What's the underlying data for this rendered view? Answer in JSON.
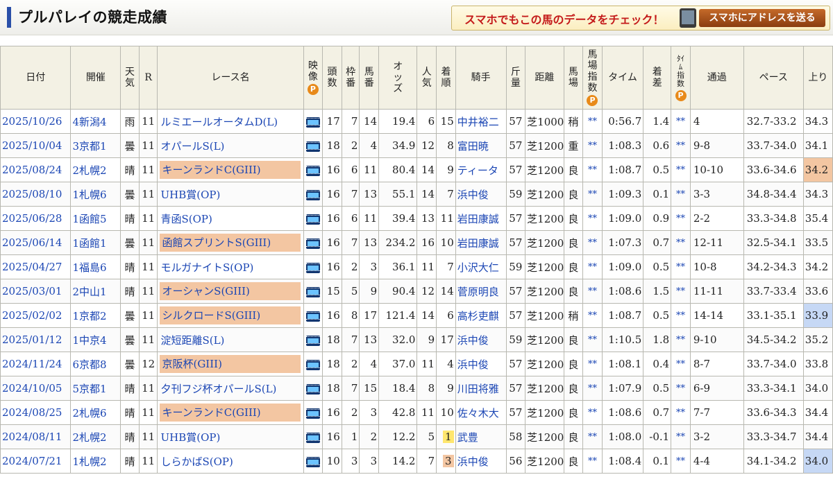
{
  "header": {
    "title": "プルパレイの競走成績",
    "promo_text": "スマホでもこの馬のデータをチェック！",
    "send_button": "スマホにアドレスを送る"
  },
  "columns": {
    "date": "日付",
    "venue": "開催",
    "weather": "天気",
    "race_no": "R",
    "race_name": "レース名",
    "video": "映像",
    "badge": "P",
    "runners": "頭数",
    "frame": "枠番",
    "horse_no": "馬番",
    "odds": "オッズ",
    "popularity": "人気",
    "finish": "着順",
    "jockey": "騎手",
    "weight": "斤量",
    "distance": "距離",
    "track": "馬場",
    "track_index": "馬場指数",
    "time": "タイム",
    "margin": "着差",
    "time_index": "ﾀｲﾑ指数",
    "passing": "通過",
    "pace": "ペース",
    "last": "上り"
  },
  "rows": [
    {
      "date": "2025/10/26",
      "venue": "4新潟4",
      "weather": "雨",
      "race_no": "11",
      "race_name": "ルミエールオータムD(L)",
      "graded": false,
      "runners": "17",
      "frame": "7",
      "horse_no": "14",
      "odds": "19.4",
      "popularity": "6",
      "finish": "15",
      "finish_hl": "",
      "jockey": "中井裕二",
      "weight": "57",
      "distance": "芝1000",
      "track": "稍",
      "track_index": "**",
      "time": "0:56.7",
      "margin": "1.4",
      "time_index": "**",
      "passing": "4",
      "pace": "32.7-33.2",
      "last": "34.3",
      "last_hl": ""
    },
    {
      "date": "2025/10/04",
      "venue": "3京都1",
      "weather": "曇",
      "race_no": "11",
      "race_name": "オパールS(L)",
      "graded": false,
      "runners": "18",
      "frame": "2",
      "horse_no": "4",
      "odds": "34.9",
      "popularity": "12",
      "finish": "8",
      "finish_hl": "",
      "jockey": "富田暁",
      "weight": "57",
      "distance": "芝1200",
      "track": "重",
      "track_index": "**",
      "time": "1:08.3",
      "margin": "0.6",
      "time_index": "**",
      "passing": "9-8",
      "pace": "33.7-34.0",
      "last": "34.1",
      "last_hl": ""
    },
    {
      "date": "2025/08/24",
      "venue": "2札幌2",
      "weather": "晴",
      "race_no": "11",
      "race_name": "キーンランドC(GIII)",
      "graded": true,
      "runners": "16",
      "frame": "6",
      "horse_no": "11",
      "odds": "80.4",
      "popularity": "14",
      "finish": "9",
      "finish_hl": "",
      "jockey": "ティータ",
      "weight": "57",
      "distance": "芝1200",
      "track": "良",
      "track_index": "**",
      "time": "1:08.7",
      "margin": "0.5",
      "time_index": "**",
      "passing": "10-10",
      "pace": "33.6-34.6",
      "last": "34.2",
      "last_hl": "orange"
    },
    {
      "date": "2025/08/10",
      "venue": "1札幌6",
      "weather": "曇",
      "race_no": "11",
      "race_name": "UHB賞(OP)",
      "graded": false,
      "runners": "16",
      "frame": "7",
      "horse_no": "13",
      "odds": "55.1",
      "popularity": "14",
      "finish": "7",
      "finish_hl": "",
      "jockey": "浜中俊",
      "weight": "59",
      "distance": "芝1200",
      "track": "良",
      "track_index": "**",
      "time": "1:09.3",
      "margin": "0.1",
      "time_index": "**",
      "passing": "3-3",
      "pace": "34.8-34.4",
      "last": "34.3",
      "last_hl": ""
    },
    {
      "date": "2025/06/28",
      "venue": "1函館5",
      "weather": "晴",
      "race_no": "11",
      "race_name": "青函S(OP)",
      "graded": false,
      "runners": "16",
      "frame": "6",
      "horse_no": "11",
      "odds": "39.4",
      "popularity": "13",
      "finish": "11",
      "finish_hl": "",
      "jockey": "岩田康誠",
      "weight": "57",
      "distance": "芝1200",
      "track": "良",
      "track_index": "**",
      "time": "1:09.0",
      "margin": "0.9",
      "time_index": "**",
      "passing": "2-2",
      "pace": "33.3-34.8",
      "last": "35.4",
      "last_hl": ""
    },
    {
      "date": "2025/06/14",
      "venue": "1函館1",
      "weather": "曇",
      "race_no": "11",
      "race_name": "函館スプリントS(GIII)",
      "graded": true,
      "runners": "16",
      "frame": "7",
      "horse_no": "13",
      "odds": "234.2",
      "popularity": "16",
      "finish": "10",
      "finish_hl": "",
      "jockey": "岩田康誠",
      "weight": "57",
      "distance": "芝1200",
      "track": "良",
      "track_index": "**",
      "time": "1:07.3",
      "margin": "0.7",
      "time_index": "**",
      "passing": "12-11",
      "pace": "32.5-34.1",
      "last": "33.5",
      "last_hl": ""
    },
    {
      "date": "2025/04/27",
      "venue": "1福島6",
      "weather": "晴",
      "race_no": "11",
      "race_name": "モルガナイトS(OP)",
      "graded": false,
      "runners": "16",
      "frame": "2",
      "horse_no": "3",
      "odds": "36.1",
      "popularity": "11",
      "finish": "7",
      "finish_hl": "",
      "jockey": "小沢大仁",
      "weight": "59",
      "distance": "芝1200",
      "track": "良",
      "track_index": "**",
      "time": "1:09.0",
      "margin": "0.5",
      "time_index": "**",
      "passing": "10-8",
      "pace": "34.2-34.3",
      "last": "34.2",
      "last_hl": ""
    },
    {
      "date": "2025/03/01",
      "venue": "2中山1",
      "weather": "晴",
      "race_no": "11",
      "race_name": "オーシャンS(GIII)",
      "graded": true,
      "runners": "15",
      "frame": "5",
      "horse_no": "9",
      "odds": "90.4",
      "popularity": "12",
      "finish": "14",
      "finish_hl": "",
      "jockey": "菅原明良",
      "weight": "57",
      "distance": "芝1200",
      "track": "良",
      "track_index": "**",
      "time": "1:08.6",
      "margin": "1.5",
      "time_index": "**",
      "passing": "11-11",
      "pace": "33.7-33.4",
      "last": "33.6",
      "last_hl": ""
    },
    {
      "date": "2025/02/02",
      "venue": "1京都2",
      "weather": "曇",
      "race_no": "11",
      "race_name": "シルクロードS(GIII)",
      "graded": true,
      "runners": "16",
      "frame": "8",
      "horse_no": "17",
      "odds": "121.4",
      "popularity": "14",
      "finish": "6",
      "finish_hl": "",
      "jockey": "高杉吏麒",
      "weight": "57",
      "distance": "芝1200",
      "track": "稍",
      "track_index": "**",
      "time": "1:08.7",
      "margin": "0.5",
      "time_index": "**",
      "passing": "14-14",
      "pace": "33.1-35.1",
      "last": "33.9",
      "last_hl": "blue"
    },
    {
      "date": "2025/01/12",
      "venue": "1中京4",
      "weather": "曇",
      "race_no": "11",
      "race_name": "淀短距離S(L)",
      "graded": false,
      "runners": "18",
      "frame": "7",
      "horse_no": "13",
      "odds": "32.0",
      "popularity": "9",
      "finish": "17",
      "finish_hl": "",
      "jockey": "浜中俊",
      "weight": "59",
      "distance": "芝1200",
      "track": "良",
      "track_index": "**",
      "time": "1:10.5",
      "margin": "1.8",
      "time_index": "**",
      "passing": "9-10",
      "pace": "34.5-34.2",
      "last": "35.2",
      "last_hl": ""
    },
    {
      "date": "2024/11/24",
      "venue": "6京都8",
      "weather": "曇",
      "race_no": "12",
      "race_name": "京阪杯(GIII)",
      "graded": true,
      "runners": "18",
      "frame": "2",
      "horse_no": "4",
      "odds": "37.0",
      "popularity": "11",
      "finish": "4",
      "finish_hl": "",
      "jockey": "浜中俊",
      "weight": "57",
      "distance": "芝1200",
      "track": "良",
      "track_index": "**",
      "time": "1:08.1",
      "margin": "0.4",
      "time_index": "**",
      "passing": "8-7",
      "pace": "33.7-34.0",
      "last": "33.8",
      "last_hl": ""
    },
    {
      "date": "2024/10/05",
      "venue": "5京都1",
      "weather": "晴",
      "race_no": "11",
      "race_name": "夕刊フジ杯オパールS(L)",
      "graded": false,
      "runners": "18",
      "frame": "7",
      "horse_no": "15",
      "odds": "18.4",
      "popularity": "8",
      "finish": "9",
      "finish_hl": "",
      "jockey": "川田将雅",
      "weight": "57",
      "distance": "芝1200",
      "track": "良",
      "track_index": "**",
      "time": "1:07.9",
      "margin": "0.5",
      "time_index": "**",
      "passing": "6-9",
      "pace": "33.3-34.1",
      "last": "34.0",
      "last_hl": ""
    },
    {
      "date": "2024/08/25",
      "venue": "2札幌6",
      "weather": "晴",
      "race_no": "11",
      "race_name": "キーンランドC(GIII)",
      "graded": true,
      "runners": "16",
      "frame": "2",
      "horse_no": "3",
      "odds": "42.8",
      "popularity": "11",
      "finish": "10",
      "finish_hl": "",
      "jockey": "佐々木大",
      "weight": "57",
      "distance": "芝1200",
      "track": "良",
      "track_index": "**",
      "time": "1:08.6",
      "margin": "0.7",
      "time_index": "**",
      "passing": "7-7",
      "pace": "33.6-34.3",
      "last": "34.4",
      "last_hl": ""
    },
    {
      "date": "2024/08/11",
      "venue": "2札幌2",
      "weather": "晴",
      "race_no": "11",
      "race_name": "UHB賞(OP)",
      "graded": false,
      "runners": "16",
      "frame": "1",
      "horse_no": "2",
      "odds": "12.2",
      "popularity": "5",
      "finish": "1",
      "finish_hl": "1",
      "jockey": "武豊",
      "weight": "58",
      "distance": "芝1200",
      "track": "良",
      "track_index": "**",
      "time": "1:08.0",
      "margin": "-0.1",
      "time_index": "**",
      "passing": "3-2",
      "pace": "33.3-34.7",
      "last": "34.4",
      "last_hl": ""
    },
    {
      "date": "2024/07/21",
      "venue": "1札幌2",
      "weather": "晴",
      "race_no": "11",
      "race_name": "しらかばS(OP)",
      "graded": false,
      "runners": "10",
      "frame": "3",
      "horse_no": "3",
      "odds": "14.2",
      "popularity": "7",
      "finish": "3",
      "finish_hl": "3",
      "jockey": "浜中俊",
      "weight": "56",
      "distance": "芝1200",
      "track": "良",
      "track_index": "**",
      "time": "1:08.4",
      "margin": "0.1",
      "time_index": "**",
      "passing": "4-4",
      "pace": "34.1-34.2",
      "last": "34.0",
      "last_hl": "blue"
    }
  ]
}
